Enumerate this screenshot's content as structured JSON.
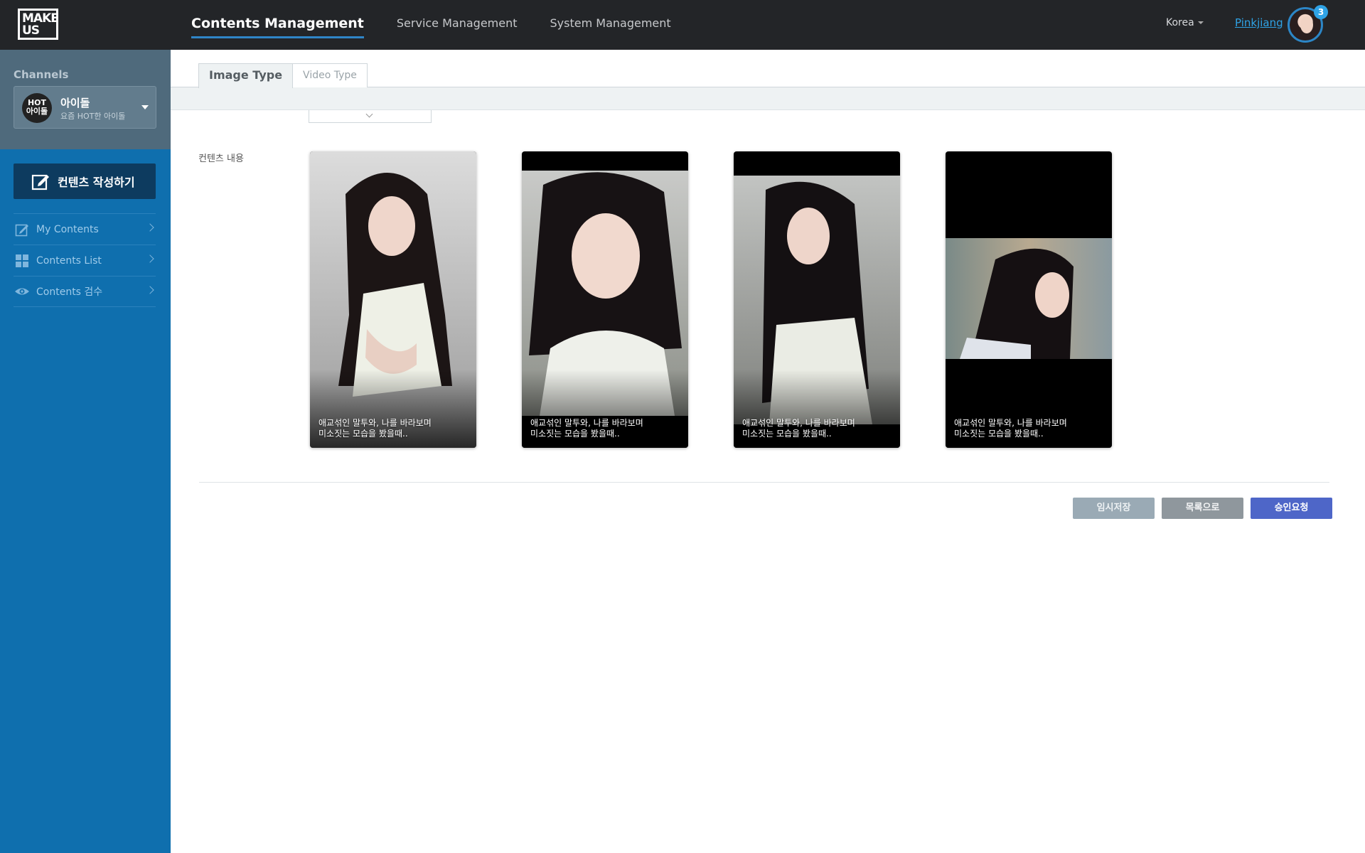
{
  "app": {
    "logo_line1": "MAKE",
    "logo_line2": "US"
  },
  "topnav": {
    "items": [
      {
        "label": "Contents Management",
        "active": true
      },
      {
        "label": "Service Management",
        "active": false
      },
      {
        "label": "System Management",
        "active": false
      }
    ],
    "region": "Korea",
    "username": "Pinkjiang",
    "notification_count": "3"
  },
  "sidebar": {
    "channels_title": "Channels",
    "channel": {
      "logo_line1": "HOT",
      "logo_line2": "아이돌",
      "name": "아이돌",
      "subtitle": "요즘 HOT한 아이돌"
    },
    "create_button": "컨텐츠 작성하기",
    "items": [
      {
        "label": "My Contents",
        "icon": "edit-icon"
      },
      {
        "label": "Contents List",
        "icon": "grid-icon"
      },
      {
        "label": "Contents 검수",
        "icon": "eye-icon"
      }
    ]
  },
  "main": {
    "tabs": [
      {
        "label": "Image Type",
        "active": true
      },
      {
        "label": "Video Type",
        "active": false
      }
    ],
    "field_label": "컨텐츠 내용",
    "cards": [
      {
        "caption": "애교섞인 말투와, 나를 바라보며\n미소짓는 모습을 봤을때.."
      },
      {
        "caption": "애교섞인 말투와, 나를 바라보며\n미소짓는 모습을 봤을때.."
      },
      {
        "caption": "애교섞인 말투와, 나를 바라보며\n미소짓는 모습을 봤을때.."
      },
      {
        "caption": "애교섞인 말투와, 나를 바라보며\n미소짓는 모습을 봤을때.."
      }
    ],
    "buttons": {
      "temp_save": "임시저장",
      "to_list": "목록으로",
      "request_approval": "승인요청"
    }
  },
  "colors": {
    "topbar": "#232528",
    "sidebar": "#0f6fae",
    "accent": "#2f86c8",
    "approve": "#4e66c8"
  }
}
